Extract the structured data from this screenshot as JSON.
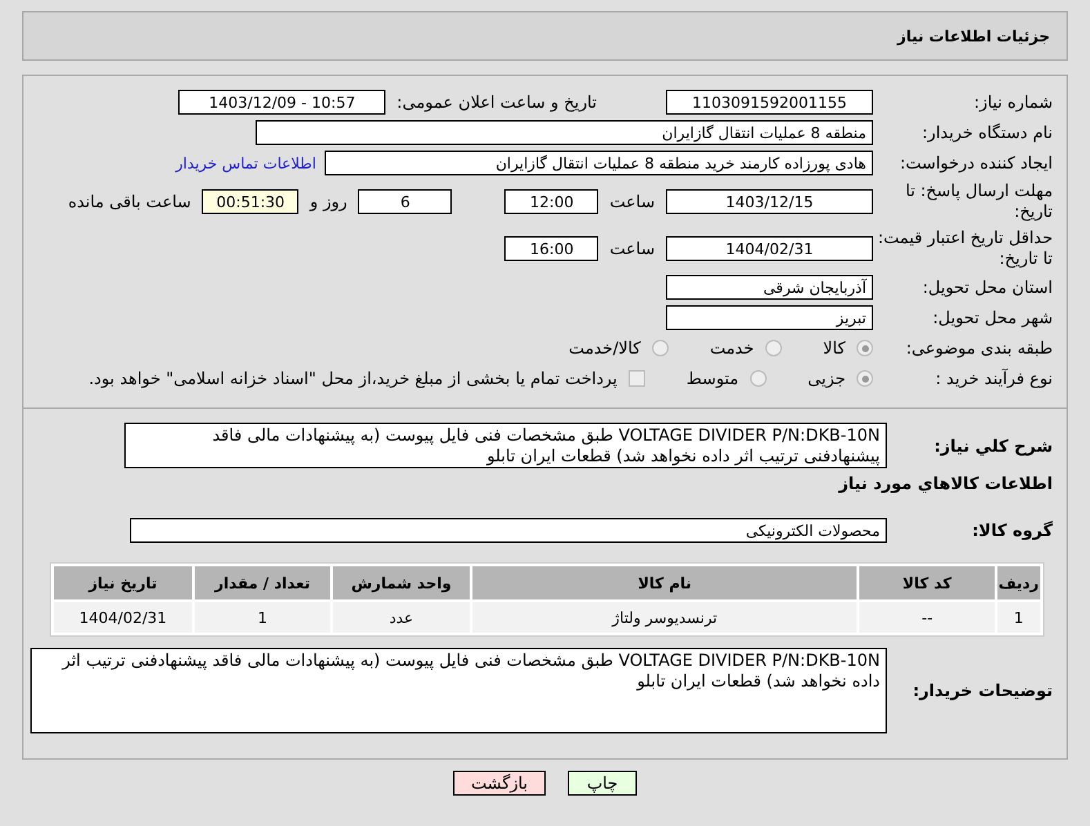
{
  "header": {
    "title": "جزئیات اطلاعات نیاز"
  },
  "fields": {
    "need_number": {
      "label": "شماره نیاز:",
      "value": "1103091592001155"
    },
    "announce": {
      "label": "تاریخ و ساعت اعلان عمومی:",
      "value": "1403/12/09 - 10:57"
    },
    "buyer": {
      "label": "نام دستگاه خریدار:",
      "value": "منطقه 8 عملیات انتقال گازایران"
    },
    "requester": {
      "label": "ایجاد کننده درخواست:",
      "value": "هادی پورزاده کارمند خرید منطقه 8 عملیات انتقال گازایران",
      "link": "اطلاعات تماس خریدار"
    },
    "deadline": {
      "label": "مهلت ارسال پاسخ: تا تاریخ:",
      "date": "1403/12/15",
      "time_label": "ساعت",
      "time": "12:00",
      "days": "6",
      "days_label": "روز و",
      "remaining": "00:51:30",
      "remaining_label": "ساعت باقی مانده"
    },
    "validity": {
      "label": "حداقل تاریخ اعتبار قیمت: تا تاریخ:",
      "date": "1404/02/31",
      "time_label": "ساعت",
      "time": "16:00"
    },
    "province": {
      "label": "استان محل تحویل:",
      "value": "آذربایجان شرقی"
    },
    "city": {
      "label": "شهر محل تحویل:",
      "value": "تبریز"
    },
    "category": {
      "label": "طبقه بندی موضوعی:",
      "options": [
        {
          "label": "کالا",
          "selected": true
        },
        {
          "label": "خدمت",
          "selected": false
        },
        {
          "label": "کالا/خدمت",
          "selected": false
        }
      ]
    },
    "process": {
      "label": "نوع فرآیند خرید :",
      "options": [
        {
          "label": "جزیی",
          "selected": true
        },
        {
          "label": "متوسط",
          "selected": false
        }
      ],
      "payment": {
        "label": "پرداخت تمام یا بخشی از مبلغ خرید،از محل \"اسناد خزانه اسلامی\" خواهد بود.",
        "checked": false
      }
    }
  },
  "summary": {
    "label": "شرح کلي نياز:",
    "value": "VOLTAGE DIVIDER P/N:DKB-10N طبق مشخصات فنی فایل پیوست (به پیشنهادات مالی فاقد پیشنهادفنی ترتیب اثر داده نخواهد شد) قطعات ایران تابلو"
  },
  "goods_heading": "اطلاعات کالاهاي مورد نياز",
  "goods_group": {
    "label": "گروه کالا:",
    "value": "محصولات الکترونیکی"
  },
  "table": {
    "columns": [
      "ردیف",
      "کد کالا",
      "نام کالا",
      "واحد شمارش",
      "تعداد / مقدار",
      "تاریخ نیاز"
    ],
    "rows": [
      [
        "1",
        "--",
        "ترنسدیوسر ولتاژ",
        "عدد",
        "1",
        "1404/02/31"
      ]
    ]
  },
  "buyer_notes": {
    "label": "توضیحات خریدار:",
    "value": "VOLTAGE DIVIDER P/N:DKB-10N طبق مشخصات فنی فایل پیوست (به پیشنهادات مالی فاقد پیشنهادفنی ترتیب اثر داده نخواهد شد) قطعات ایران تابلو"
  },
  "buttons": [
    {
      "label": "چاپ",
      "kind": "print"
    },
    {
      "label": "بازگشت",
      "kind": "back"
    }
  ]
}
